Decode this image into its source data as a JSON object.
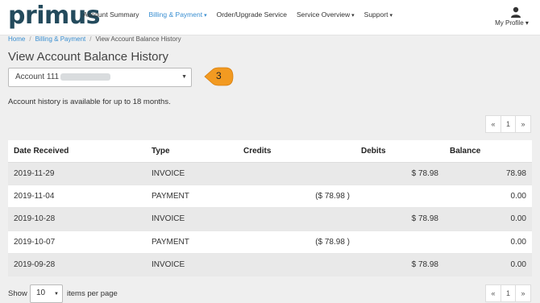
{
  "brand": {
    "logo_text": "primus"
  },
  "nav": {
    "items": [
      {
        "label": "Account Summary",
        "caret": ""
      },
      {
        "label": "Billing & Payment",
        "caret": "▾"
      },
      {
        "label": "Order/Upgrade Service",
        "caret": ""
      },
      {
        "label": "Service Overview",
        "caret": "▾"
      },
      {
        "label": "Support",
        "caret": "▾"
      }
    ],
    "active_index": 1,
    "active_color": "#3a8fd1",
    "profile_label": "My Profile ▾",
    "profile_icon": "user-icon"
  },
  "breadcrumb": {
    "items": [
      "Home",
      "Billing & Payment",
      "View Account Balance History"
    ],
    "separator": "/"
  },
  "page": {
    "title": "View Account Balance History",
    "account_select_value": "Account 111",
    "badge_number": "3",
    "badge_color": "#f29a21",
    "history_note": "Account history is available for up to 18 months."
  },
  "pagination": {
    "prev": "«",
    "current": "1",
    "next": "»"
  },
  "table": {
    "columns": [
      "Date Received",
      "Type",
      "Credits",
      "Debits",
      "Balance"
    ],
    "rows": [
      {
        "date": "2019-11-29",
        "type": "INVOICE",
        "credits": "",
        "debits": "$ 78.98",
        "balance": "78.98"
      },
      {
        "date": "2019-11-04",
        "type": "PAYMENT",
        "credits": "($ 78.98 )",
        "debits": "",
        "balance": "0.00"
      },
      {
        "date": "2019-10-28",
        "type": "INVOICE",
        "credits": "",
        "debits": "$ 78.98",
        "balance": "0.00"
      },
      {
        "date": "2019-10-07",
        "type": "PAYMENT",
        "credits": "($ 78.98 )",
        "debits": "",
        "balance": "0.00"
      },
      {
        "date": "2019-09-28",
        "type": "INVOICE",
        "credits": "",
        "debits": "$ 78.98",
        "balance": "0.00"
      }
    ]
  },
  "footer": {
    "show_label": "Show",
    "per_page_value": "10",
    "items_label": "items per page"
  }
}
